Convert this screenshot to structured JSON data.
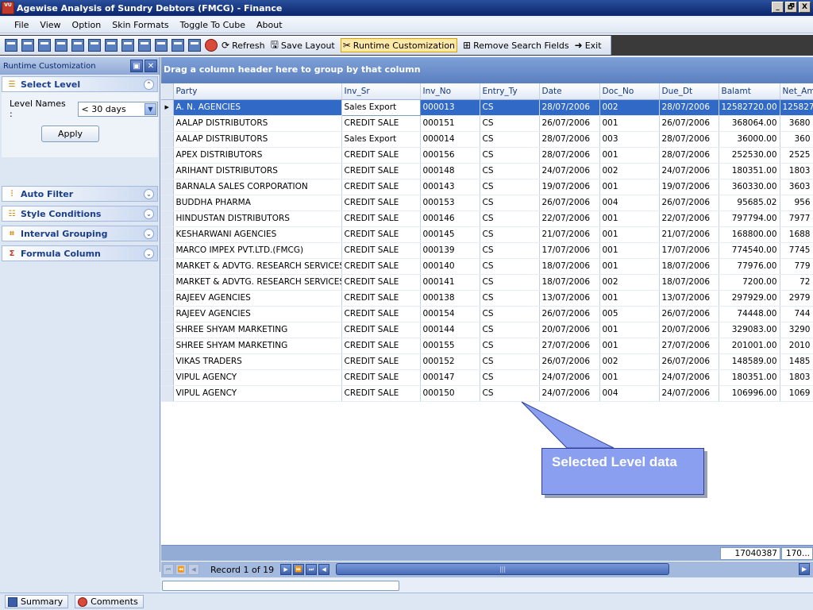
{
  "window": {
    "title": "Agewise Analysis of Sundry Debtors (FMCG) - Finance",
    "app_icon_text": "VU",
    "controls": [
      "_",
      "🗗",
      "X"
    ]
  },
  "menu": [
    "File",
    "View",
    "Option",
    "Skin Formats",
    "Toggle To Cube",
    "About"
  ],
  "toolbar": {
    "refresh": "Refresh",
    "save_layout": "Save Layout",
    "runtime_customization": "Runtime Customization",
    "remove_search_fields": "Remove Search Fields",
    "exit": "Exit"
  },
  "left_panel": {
    "header": "Runtime Customization",
    "select_level": {
      "title": "Select Level",
      "level_label": "Level Names :",
      "level_value": "< 30 days",
      "apply": "Apply"
    },
    "sections": [
      "Auto Filter",
      "Style Conditions",
      "Interval Grouping",
      "Formula Column"
    ]
  },
  "grid": {
    "group_hint": "Drag a column header here to group by that column",
    "columns": [
      "Party",
      "Inv_Sr",
      "Inv_No",
      "Entry_Ty",
      "Date",
      "Doc_No",
      "Due_Dt",
      "Balamt",
      "Net_Amt"
    ],
    "rows": [
      [
        "A. N. AGENCIES",
        "Sales Export",
        "000013",
        "CS",
        "28/07/2006",
        "002",
        "28/07/2006",
        "12582720.00",
        "125827"
      ],
      [
        "AALAP DISTRIBUTORS",
        "CREDIT SALE",
        "000151",
        "CS",
        "26/07/2006",
        "001",
        "26/07/2006",
        "368064.00",
        "3680"
      ],
      [
        "AALAP DISTRIBUTORS",
        "Sales Export",
        "000014",
        "CS",
        "28/07/2006",
        "003",
        "28/07/2006",
        "36000.00",
        "360"
      ],
      [
        "APEX DISTRIBUTORS",
        "CREDIT SALE",
        "000156",
        "CS",
        "28/07/2006",
        "001",
        "28/07/2006",
        "252530.00",
        "2525"
      ],
      [
        "ARIHANT DISTRIBUTORS",
        "CREDIT SALE",
        "000148",
        "CS",
        "24/07/2006",
        "002",
        "24/07/2006",
        "180351.00",
        "1803"
      ],
      [
        "BARNALA SALES CORPORATION",
        "CREDIT SALE",
        "000143",
        "CS",
        "19/07/2006",
        "001",
        "19/07/2006",
        "360330.00",
        "3603"
      ],
      [
        "BUDDHA PHARMA",
        "CREDIT SALE",
        "000153",
        "CS",
        "26/07/2006",
        "004",
        "26/07/2006",
        "95685.02",
        "956"
      ],
      [
        "HINDUSTAN DISTRIBUTORS",
        "CREDIT SALE",
        "000146",
        "CS",
        "22/07/2006",
        "001",
        "22/07/2006",
        "797794.00",
        "7977"
      ],
      [
        "KESHARWANI AGENCIES",
        "CREDIT SALE",
        "000145",
        "CS",
        "21/07/2006",
        "001",
        "21/07/2006",
        "168800.00",
        "1688"
      ],
      [
        "MARCO IMPEX PVT.LTD.(FMCG)",
        "CREDIT SALE",
        "000139",
        "CS",
        "17/07/2006",
        "001",
        "17/07/2006",
        "774540.00",
        "7745"
      ],
      [
        "MARKET & ADVTG. RESEARCH SERVICES",
        "CREDIT SALE",
        "000140",
        "CS",
        "18/07/2006",
        "001",
        "18/07/2006",
        "77976.00",
        "779"
      ],
      [
        "MARKET & ADVTG. RESEARCH SERVICES",
        "CREDIT SALE",
        "000141",
        "CS",
        "18/07/2006",
        "002",
        "18/07/2006",
        "7200.00",
        "72"
      ],
      [
        "RAJEEV AGENCIES",
        "CREDIT SALE",
        "000138",
        "CS",
        "13/07/2006",
        "001",
        "13/07/2006",
        "297929.00",
        "2979"
      ],
      [
        "RAJEEV AGENCIES",
        "CREDIT SALE",
        "000154",
        "CS",
        "26/07/2006",
        "005",
        "26/07/2006",
        "74448.00",
        "744"
      ],
      [
        "SHREE SHYAM MARKETING",
        "CREDIT SALE",
        "000144",
        "CS",
        "20/07/2006",
        "001",
        "20/07/2006",
        "329083.00",
        "3290"
      ],
      [
        "SHREE SHYAM MARKETING",
        "CREDIT SALE",
        "000155",
        "CS",
        "27/07/2006",
        "001",
        "27/07/2006",
        "201001.00",
        "2010"
      ],
      [
        "VIKAS TRADERS",
        "CREDIT SALE",
        "000152",
        "CS",
        "26/07/2006",
        "002",
        "26/07/2006",
        "148589.00",
        "1485"
      ],
      [
        "VIPUL AGENCY",
        "CREDIT SALE",
        "000147",
        "CS",
        "24/07/2006",
        "001",
        "24/07/2006",
        "180351.00",
        "1803"
      ],
      [
        "VIPUL AGENCY",
        "CREDIT SALE",
        "000150",
        "CS",
        "24/07/2006",
        "004",
        "24/07/2006",
        "106996.00",
        "1069"
      ]
    ],
    "totals": {
      "balamt": "17040387",
      "net_amt": "170..."
    },
    "record_text": "Record 1 of 19"
  },
  "callout": {
    "text": "Selected Level data"
  },
  "status_tabs": [
    "Summary",
    "Comments"
  ],
  "colors": {
    "selection": "#3169c6",
    "callout_fill": "#8b9ff0",
    "group_panel": "#5b80c0"
  }
}
